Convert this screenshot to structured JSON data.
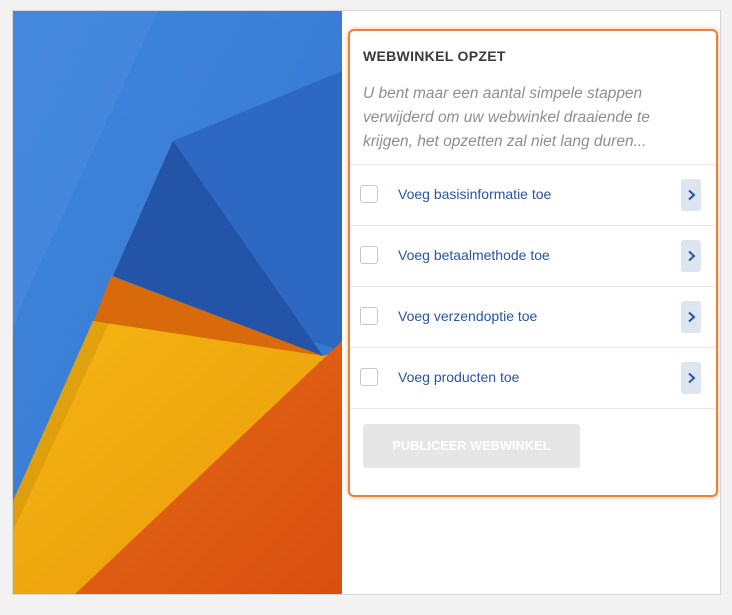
{
  "colors": {
    "accent_orange": "#ee7f3a",
    "link_blue": "#2b53a6",
    "art_blue": "#3a7dd6",
    "art_dark_blue": "#2354a8",
    "art_yellow": "#f1a90f",
    "art_orange": "#df5a12"
  },
  "setup": {
    "title": "WEBWINKEL OPZET",
    "description": "U bent maar een aantal simpele stappen verwijderd om uw webwinkel draaiende te krijgen, het opzetten zal niet lang duren...",
    "steps": [
      {
        "label": "Voeg basisinformatie toe",
        "checked": false,
        "icon": "chevron-right-icon"
      },
      {
        "label": "Voeg betaalmethode toe",
        "checked": false,
        "icon": "chevron-right-icon"
      },
      {
        "label": "Voeg verzendoptie toe",
        "checked": false,
        "icon": "chevron-right-icon"
      },
      {
        "label": "Voeg producten toe",
        "checked": false,
        "icon": "chevron-right-icon"
      }
    ],
    "publish_button": "PUBLICEER WEBWINKEL"
  }
}
